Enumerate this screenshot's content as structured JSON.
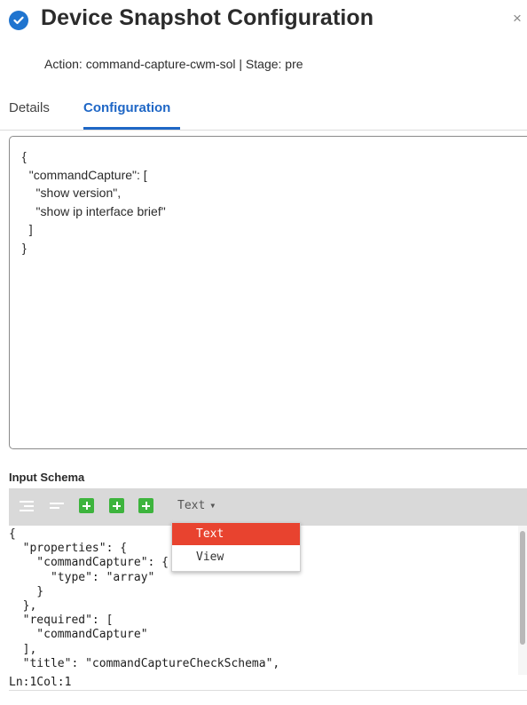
{
  "header": {
    "title": "Device Snapshot Configuration",
    "subtitle": "Action: command-capture-cwm-sol | Stage: pre",
    "close_symbol": "×",
    "accent_color": "#1f74cf"
  },
  "tabs": [
    {
      "label": "Details",
      "active": false
    },
    {
      "label": "Configuration",
      "active": true
    }
  ],
  "config_editor": {
    "content": "{\n  \"commandCapture\": [\n    \"show version\",\n    \"show ip interface brief\"\n  ]\n}"
  },
  "input_schema": {
    "label": "Input Schema",
    "toolbar": {
      "icons": [
        "indent-icon",
        "compact-icon",
        "add-icon",
        "add-icon",
        "add-icon"
      ],
      "mode_label": "Text",
      "mode_options": [
        "Text",
        "View"
      ],
      "selected_mode": "Text",
      "selected_color": "#e8432f"
    },
    "code": "{\n  \"properties\": {\n    \"commandCapture\": {\n      \"type\": \"array\"\n    }\n  },\n  \"required\": [\n    \"commandCapture\"\n  ],\n  \"title\": \"commandCaptureCheckSchema\",",
    "status": "Ln:1Col:1"
  }
}
